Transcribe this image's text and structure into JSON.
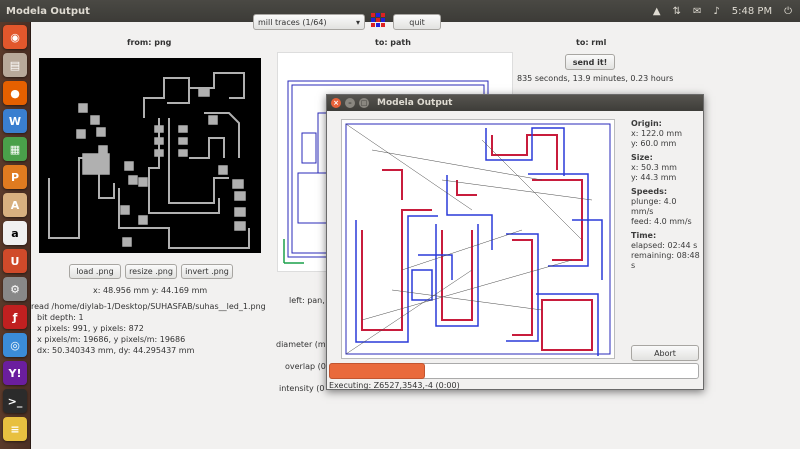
{
  "topbar": {
    "title": "Modela Output",
    "time": "5:48 PM"
  },
  "launcher": {
    "icons": [
      "ubuntu-home-icon",
      "files-icon",
      "firefox-icon",
      "writer-icon",
      "calc-icon",
      "impress-icon",
      "software-center-icon",
      "amazon-icon",
      "ubuntu-one-icon",
      "settings-icon",
      "flash-icon",
      "chromium-icon",
      "yahoo-icon",
      "terminal-icon",
      "layers-icon"
    ]
  },
  "toolbar": {
    "select_value": "mill traces (1/64)",
    "quit_label": "quit"
  },
  "columns": {
    "from_png": "from: png",
    "to_path": "to: path",
    "to_rml": "to: rml"
  },
  "rml": {
    "send_label": "send it!",
    "time_text": "835 seconds, 13.9 minutes, 0.23 hours"
  },
  "png_buttons": {
    "load": "load .png",
    "resize": "resize .png",
    "invert": "invert .png"
  },
  "coords": {
    "text": "x: 48.956 mm  y: 44.169 mm"
  },
  "file_info": {
    "read": "read /home/diylab-1/Desktop/SUHASFAB/suhas__led_1.png",
    "bit_depth": "bit depth: 1",
    "pixels": "x pixels: 991, y pixels: 872",
    "ppm": "x pixels/m: 19686, y pixels/m: 19686",
    "dx": "dx: 50.340343 mm, dy: 44.295437 mm"
  },
  "path_params": {
    "left_pan": "left: pan,",
    "diameter": "diameter (m",
    "overlap": "overlap (0",
    "intensity": "intensity (0"
  },
  "dialog": {
    "title": "Modela Output",
    "origin_h": "Origin:",
    "origin_x": "x: 122.0 mm",
    "origin_y": "y: 60.0 mm",
    "size_h": "Size:",
    "size_x": "x: 50.3 mm",
    "size_y": "y: 44.3 mm",
    "speeds_h": "Speeds:",
    "plunge": "plunge: 4.0 mm/s",
    "feed": "feed: 4.0 mm/s",
    "time_h": "Time:",
    "elapsed": "elapsed: 02:44 s",
    "remaining": "remaining: 08:48 s",
    "abort_label": "Abort",
    "progress": 0.26,
    "status": "Executing: Z6527,3543,-4 (0:00)"
  }
}
